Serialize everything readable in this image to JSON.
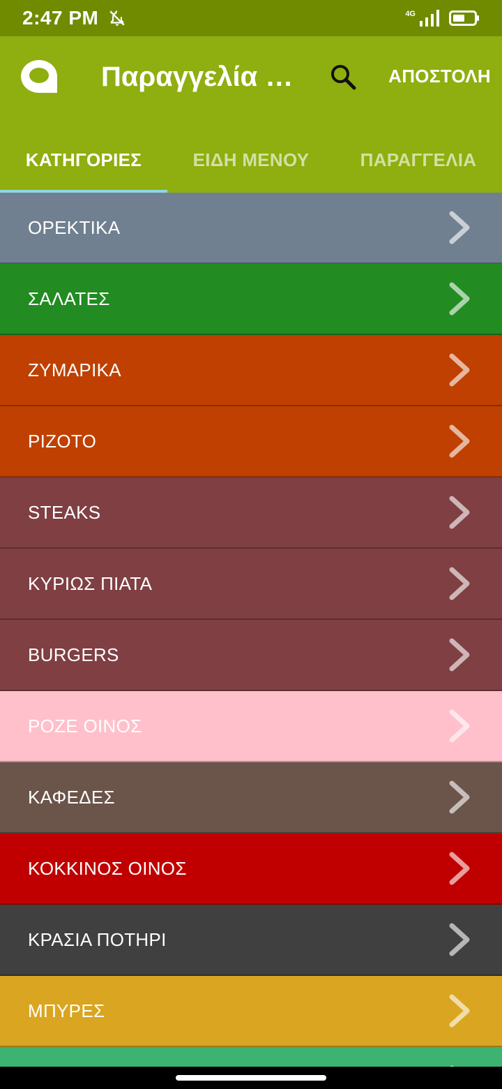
{
  "status": {
    "time": "2:47 PM",
    "network": "4G"
  },
  "app_bar": {
    "title": "Παραγγελία π...",
    "send_label": "ΑΠΟΣΤΟΛΗ"
  },
  "tabs": [
    {
      "label": "ΚΑΤΗΓΟΡΙΕΣ",
      "active": true
    },
    {
      "label": "ΕΙΔΗ ΜΕΝΟΥ",
      "active": false
    },
    {
      "label": "ΠΑΡΑΓΓΕΛΙΑ",
      "active": false
    }
  ],
  "categories": [
    {
      "label": "ΟΡΕΚΤΙΚΑ",
      "color": "#708090"
    },
    {
      "label": "ΣΑΛΑΤΕΣ",
      "color": "#228b22"
    },
    {
      "label": "ΖΥΜΑΡΙΚΑ",
      "color": "#bf4000"
    },
    {
      "label": "ΡΙΖΟΤΟ",
      "color": "#bf4000"
    },
    {
      "label": "STEAKS",
      "color": "#7f3f43"
    },
    {
      "label": "ΚΥΡΙΩΣ ΠΙΑΤΑ",
      "color": "#7f3f43"
    },
    {
      "label": "BURGERS",
      "color": "#7f3f43"
    },
    {
      "label": "ΡΟΖΕ ΟΙΝΟΣ",
      "color": "#ffc0cb"
    },
    {
      "label": "ΚΑΦΕΔΕΣ",
      "color": "#6b5449"
    },
    {
      "label": "ΚΟΚΚΙΝΟΣ ΟΙΝΟΣ",
      "color": "#c00000"
    },
    {
      "label": "ΚΡΑΣΙΑ ΠΟΤΗΡΙ",
      "color": "#404040"
    },
    {
      "label": "ΜΠΥΡΕΣ",
      "color": "#daa520"
    },
    {
      "label": "",
      "color": "#3cb371"
    }
  ],
  "icons": {
    "logo": "chat-bubble-logo-icon",
    "search": "search-icon",
    "chevron": "chevron-right-icon",
    "bell": "bell-off-icon",
    "battery": "battery-icon",
    "signal": "signal-icon"
  }
}
